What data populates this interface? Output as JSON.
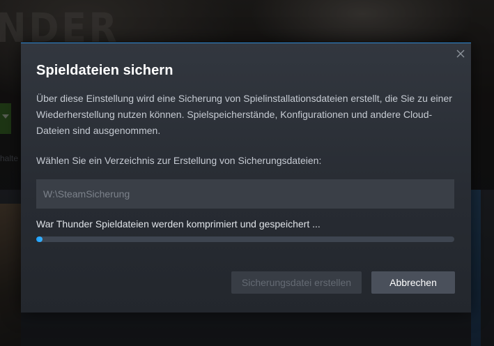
{
  "background": {
    "title_fragment": "NDER",
    "side_text": "halte"
  },
  "dialog": {
    "title": "Spieldateien sichern",
    "description": "Über diese Einstellung wird eine Sicherung von Spielinstallationsdateien erstellt, die Sie zu einer Wiederherstellung nutzen können. Spielspeicherstände, Konfigurationen und andere Cloud-Dateien sind ausgenommen.",
    "directory_label": "Wählen Sie ein Verzeichnis zur Erstellung von Sicherungsdateien:",
    "directory_value": "W:\\SteamSicherung",
    "progress_label": "War Thunder Spieldateien werden komprimiert und gespeichert ...",
    "progress_fraction": 0.015,
    "create_button_label": "Sicherungsdatei erstellen",
    "cancel_button_label": "Abbrechen",
    "close_icon": "close-icon"
  },
  "colors": {
    "accent": "#1a9fff",
    "dialog_top_border": "#2f8ad6"
  }
}
